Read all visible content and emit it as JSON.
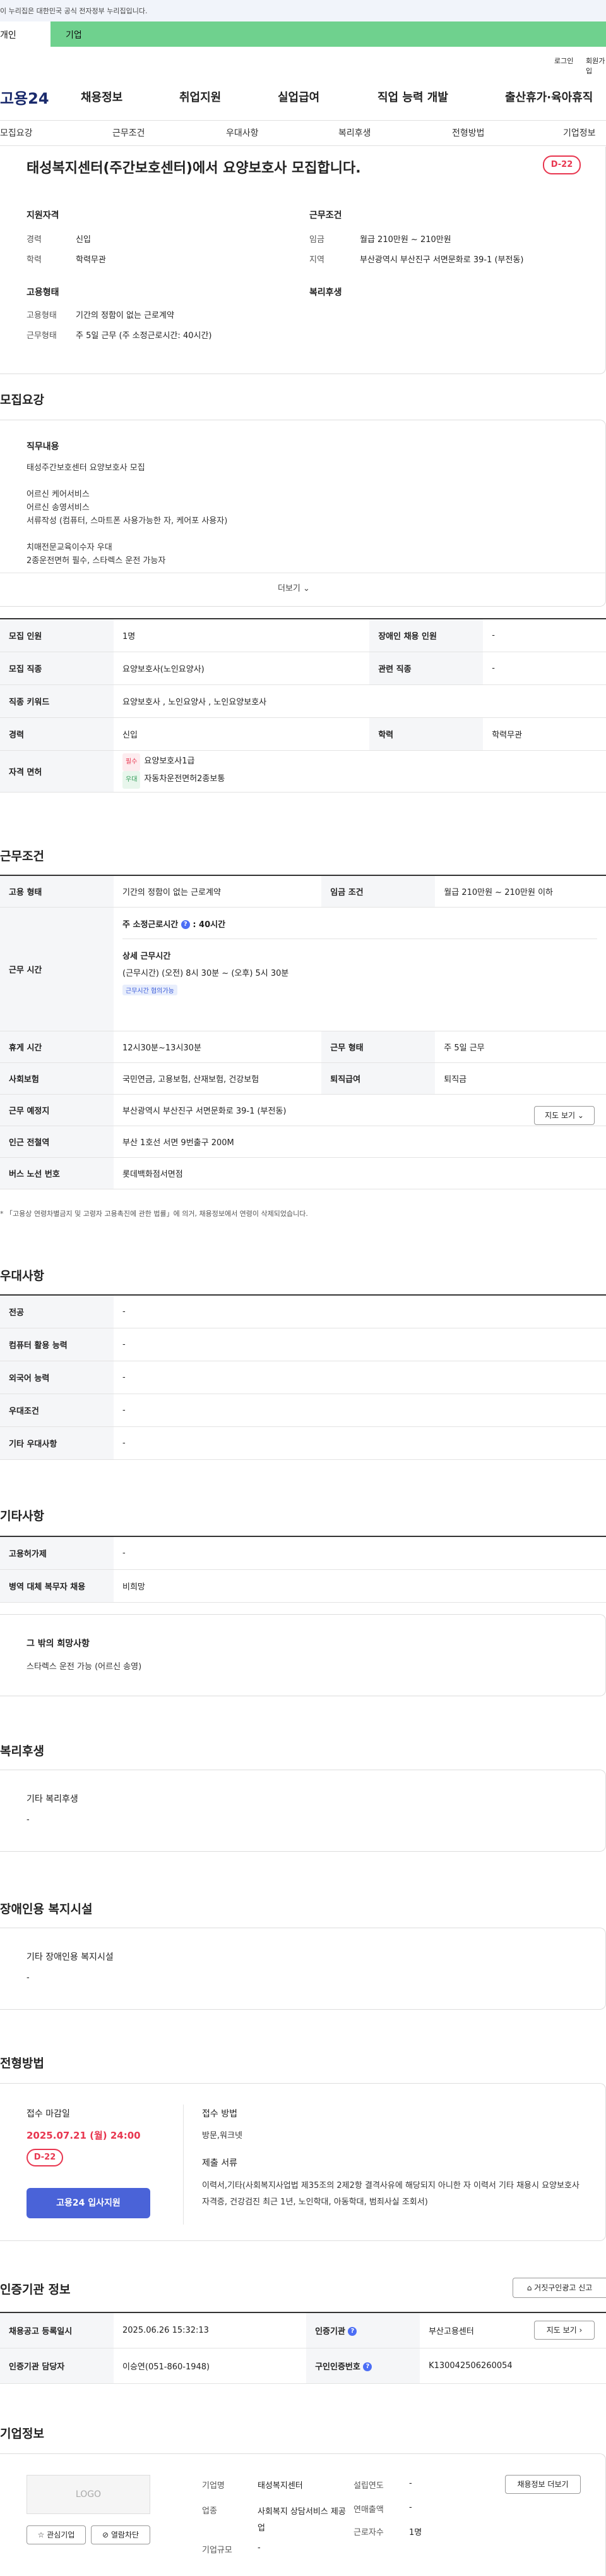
{
  "gov_notice": "이 누리집은 대한민국 공식 전자정부 누리집입니다.",
  "user_tabs": [
    "개인",
    "기업"
  ],
  "utility_links": [
    "로그인",
    "회원가입"
  ],
  "logo": "고용24",
  "main_menu": [
    "채용정보",
    "취업지원",
    "실업급여",
    "직업 능력 개발",
    "출산휴가·육아휴직"
  ],
  "sub_tabs": [
    "모집요강",
    "근무조건",
    "우대사항",
    "복리후생",
    "전형방법",
    "기업정보"
  ],
  "job_title": "태성복지센터(주간보호센터)에서 요양보호사 모집합니다.",
  "dday": "D-22",
  "summary": {
    "qual_title": "지원자격",
    "career_label": "경력",
    "career_value": "신입",
    "edu_label": "학력",
    "edu_value": "학력무관",
    "cond_title": "근무조건",
    "wage_label": "임금",
    "wage_value": "월급 210만원 ~ 210만원",
    "region_label": "지역",
    "region_value": "부산광역시 부산진구 서면문화로 39-1 (부전동)",
    "emp_title": "고용형태",
    "emp_type_label": "고용형태",
    "emp_type_value": "기간의 정함이 없는 근로계약",
    "work_type_label": "근무형태",
    "work_type_value": "주 5일 근무 (주 소정근로시간: 40시간)",
    "welfare_title": "복리후생"
  },
  "recruit": {
    "title": "모집요강",
    "duty_title": "직무내용",
    "duty_lines": [
      "태성주간보호센터 요양보호사 모집",
      "",
      "어르신 케어서비스",
      "어르신 송영서비스",
      "서류작성 (컴퓨터, 스마트폰 사용가능한 자, 케어포 사용자)",
      "",
      "치매전문교육이수자 우대",
      "2종운전면허 필수, 스타렉스 운전 가능자"
    ],
    "more": "더보기",
    "rows": [
      {
        "k1": "모집 인원",
        "v1": "1명",
        "k2": "장애인 채용 인원",
        "v2": "-"
      },
      {
        "k1": "모집 직종",
        "v1": "요양보호사(노인요양사)",
        "k2": "관련 직종",
        "v2": "-"
      },
      {
        "k1": "직종 키워드",
        "v1": "요양보호사 , 노인요양사 , 노인요양보호사"
      },
      {
        "k1": "경력",
        "v1": "신입",
        "k2": "학력",
        "v2": "학력무관"
      }
    ],
    "license_label": "자격 면허",
    "license_required_chip": "필수",
    "license_required": "요양보호사1급",
    "license_pref_chip": "우대",
    "license_pref": "자동차운전면허2종보통"
  },
  "conditions": {
    "title": "근무조건",
    "emp_type_label": "고용 형태",
    "emp_type_value": "기간의 정함이 없는 근로계약",
    "wage_label": "임금 조건",
    "wage_value": "월급 210만원 ~ 210만원 이하",
    "hours_label": "근무 시간",
    "weekly_hours": "주 소정근로시간",
    "weekly_hours_value": ": 40시간",
    "detail_title": "상세 근무시간",
    "detail_value": "(근무시간) (오전) 8시 30분 ~ (오후) 5시 30분",
    "flex_chip": "근무시간 협의가능",
    "rest_label": "휴게 시간",
    "rest_value": "12시30분~13시30분",
    "work_form_label": "근무 형태",
    "work_form_value": "주 5일 근무",
    "insurance_label": "사회보험",
    "insurance_value": "국민연금, 고용보험, 산재보험, 건강보험",
    "retire_label": "퇴직급여",
    "retire_value": "퇴직금",
    "place_label": "근무 예정지",
    "place_value": "부산광역시 부산진구 서면문화로 39-1 (부전동)",
    "map_btn": "지도 보기",
    "subway_label": "인근 전철역",
    "subway_value": "부산 1호선 서면 9번출구 200M",
    "bus_label": "버스 노선 번호",
    "bus_value": "롯데백화점서면점",
    "note": "* 「고용상 연령차별금지 및 고령자 고용촉진에 관한 법률」에 의거, 채용정보에서 연령이 삭제되었습니다."
  },
  "preference": {
    "title": "우대사항",
    "rows": [
      {
        "k": "전공",
        "v": "-"
      },
      {
        "k": "컴퓨터 활용 능력",
        "v": "-"
      },
      {
        "k": "외국어 능력",
        "v": "-"
      },
      {
        "k": "우대조건",
        "v": "-"
      },
      {
        "k": "기타 우대사항",
        "v": "-"
      }
    ]
  },
  "etc": {
    "title": "기타사항",
    "rows": [
      {
        "k": "고용허가제",
        "v": "-"
      },
      {
        "k": "병역 대체 복무자 채용",
        "v": "비희망"
      }
    ],
    "wish_title": "그 밖의 희망사항",
    "wish_value": "스타렉스 운전 가능 (어르신 송영)"
  },
  "welfare": {
    "title": "복리후생",
    "sub": "기타 복리후생",
    "value": "-"
  },
  "disability": {
    "title": "장애인용 복지시설",
    "sub": "기타 장애인용 복지시설",
    "value": "-"
  },
  "selection": {
    "title": "전형방법",
    "deadline_label": "접수 마감일",
    "deadline_value": "2025.07.21 (월) 24:00",
    "dday": "D-22",
    "apply_btn": "고용24 입사지원",
    "method_label": "접수 방법",
    "method_value": "방문,워크넷",
    "docs_label": "제출 서류",
    "docs_value": "이력서,기타(사회복지사업법 제35조의 2제2항 결격사유에 해당되지 아니한 자 이력서 기타 채용시 요양보호사 자격증, 건강검진 최근 1년, 노인학대, 아동학대, 범죄사실 조회서)"
  },
  "agency": {
    "title": "인증기관 정보",
    "report_btn": "거짓구인광고 신고",
    "reg_label": "채용공고 등록일시",
    "reg_value": "2025.06.26 15:32:13",
    "org_label": "인증기관",
    "org_value": "부산고용센터",
    "map_btn": "지도 보기",
    "manager_label": "인증기관 담당자",
    "manager_value": "이승연(051-860-1948)",
    "ad_label": "구인인증번호",
    "ad_value": "K130042506260054"
  },
  "company": {
    "title": "기업정보",
    "logo_placeholder": "LOGO",
    "fav_btn": "관심기업",
    "block_btn": "열람차단",
    "name_label": "기업명",
    "name_value": "태성복지센터",
    "industry_label": "업종",
    "industry_value": "사회복지 상담서비스 제공업",
    "size_label": "기업규모",
    "size_value": "-",
    "founded_label": "설립연도",
    "founded_value": "-",
    "sales_label": "연매출액",
    "sales_value": "-",
    "workers_label": "근로자수",
    "workers_value": "1명",
    "jobs_btn": "채용정보 더보기"
  }
}
